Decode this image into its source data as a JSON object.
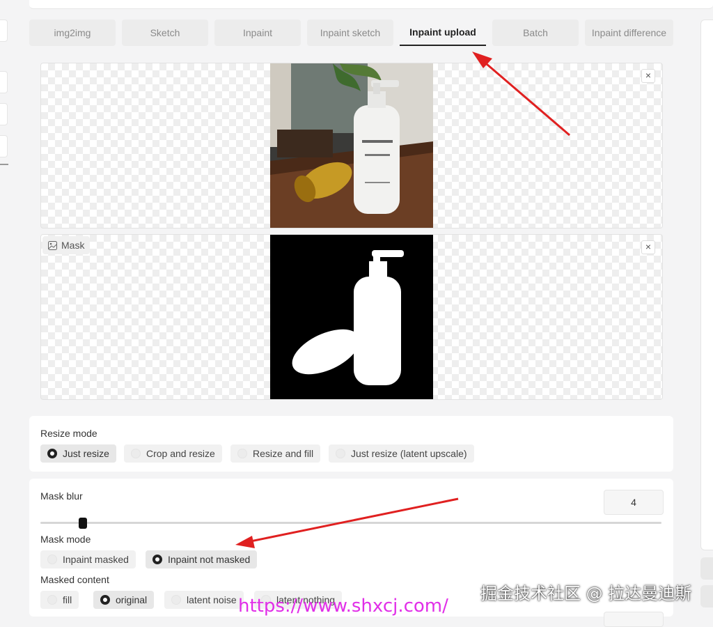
{
  "tabs": [
    {
      "label": "img2img"
    },
    {
      "label": "Sketch"
    },
    {
      "label": "Inpaint"
    },
    {
      "label": "Inpaint sketch"
    },
    {
      "label": "Inpaint upload"
    },
    {
      "label": "Batch"
    },
    {
      "label": "Inpaint difference"
    }
  ],
  "active_tab": "Inpaint upload",
  "image_panel": {
    "close": "×"
  },
  "mask_panel": {
    "label": "Mask",
    "close": "×"
  },
  "resize_mode": {
    "label": "Resize mode",
    "options": [
      "Just resize",
      "Crop and resize",
      "Resize and fill",
      "Just resize (latent upscale)"
    ],
    "selected": "Just resize"
  },
  "mask_blur": {
    "label": "Mask blur",
    "value": "4",
    "level_fraction": 0.07
  },
  "mask_mode": {
    "label": "Mask mode",
    "options": [
      "Inpaint masked",
      "Inpaint not masked"
    ],
    "selected": "Inpaint not masked"
  },
  "masked_content": {
    "label": "Masked content",
    "options": [
      "fill",
      "original",
      "latent noise",
      "latent nothing"
    ],
    "selected": "original"
  },
  "watermark": {
    "text": "掘金技术社区 @ 拉达曼迪斯",
    "url": "https://www.shxcj.com/"
  },
  "colors": {
    "annotation_arrow": "#e02020",
    "watermark_url": "#e12fe8"
  }
}
